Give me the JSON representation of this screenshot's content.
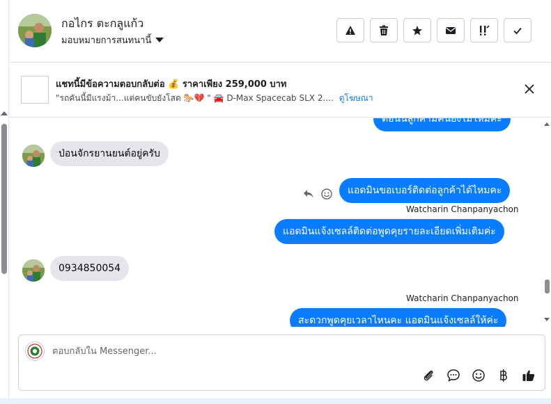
{
  "header": {
    "contact_name": "กอไกร ตะกลูแก้ว",
    "assign_label": "มอบหมายการสนทนานี้",
    "actions": [
      {
        "name": "report-button",
        "icon": "warning-icon"
      },
      {
        "name": "delete-button",
        "icon": "trash-icon"
      },
      {
        "name": "star-button",
        "icon": "star-icon"
      },
      {
        "name": "mark-unread-button",
        "icon": "envelope-icon"
      },
      {
        "name": "follow-up-button",
        "icon": "follow-up-icon"
      },
      {
        "name": "mark-done-button",
        "icon": "check-icon"
      }
    ]
  },
  "ad": {
    "title": "แชทนี้มีข้อความตอบกลับต่อ 💰 ราคาเพียง 259,000 บาท",
    "subtitle": "\"รถคันนี้มีแรงม้า...แต่คนขับยังโสด 🐎💔 \" 🚘 D-Max Spacecab SLX 2....",
    "link": "ดูโฆษณา"
  },
  "messages": {
    "m0": "ต่อนนี้ลูกค้ามีคนยังไม่ไหมคะ",
    "m1": "ป่อนจักรยานยนต์อยู่ครับ",
    "m2": "แอดมินขอเบอร์ติดต่อลูกค้าได้ไหมคะ",
    "m3_sender": "Watcharin Chanpanyachon",
    "m3": "แอดมินแจ้งเซลล์ติดต่อพูดคุยรายละเอียดเพิ่มเติมค่ะ",
    "m4": "0934850054",
    "m5_sender": "Watcharin Chanpanyachon",
    "m5": "สะดวกพูดคุยเวลาไหนคะ แอดมินแจ้งเซลล์ให้ค่ะ"
  },
  "composer": {
    "placeholder": "ตอบกลับใน Messenger...",
    "tools": [
      "paperclip-icon",
      "chat-bubble-icon",
      "emoji-icon",
      "baht-icon",
      "thumbs-up-icon"
    ]
  },
  "colors": {
    "accent": "#0a7cff",
    "incoming_bubble": "#e4e6eb",
    "link": "#1877f2"
  }
}
